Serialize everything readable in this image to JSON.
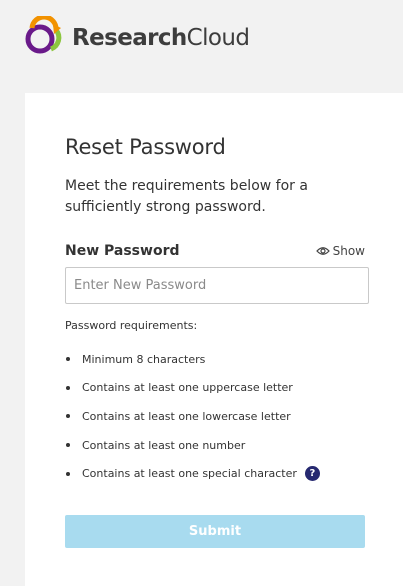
{
  "brand": {
    "name_bold": "Research",
    "name_regular": "Cloud",
    "logo_colors": [
      "#6a1a8a",
      "#f29200",
      "#8cc63f"
    ]
  },
  "form": {
    "title": "Reset Password",
    "intro": "Meet the requirements below for a sufficiently strong password.",
    "field_label": "New Password",
    "show_label": "Show",
    "show_icon": "eye-icon",
    "placeholder": "Enter New Password",
    "value": "",
    "requirements_heading": "Password requirements:",
    "requirements": [
      "Minimum 8 characters",
      "Contains at least one uppercase letter",
      "Contains at least one lowercase letter",
      "Contains at least one number",
      "Contains at least one special character"
    ],
    "help_icon": "question-icon",
    "help_glyph": "?",
    "submit_label": "Submit",
    "submit_color": "#a8dbef"
  }
}
